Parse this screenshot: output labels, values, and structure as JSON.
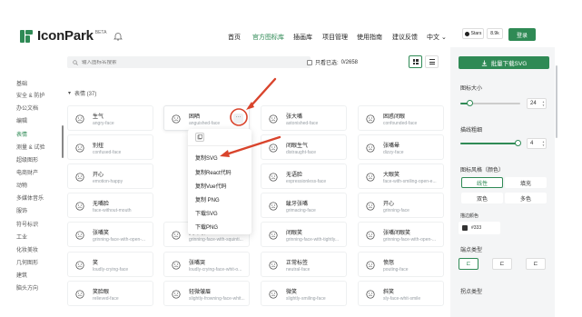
{
  "header": {
    "logo_text": "IconPark",
    "beta": "BETA",
    "nav": [
      {
        "label": "首页"
      },
      {
        "label": "官方图标库",
        "active": true
      },
      {
        "label": "插画库"
      },
      {
        "label": "项目管理"
      },
      {
        "label": "使用指南"
      },
      {
        "label": "建议反馈"
      },
      {
        "label": "中文 ⌄"
      }
    ],
    "github_label": "Stars",
    "stars_count": "8.9k",
    "login_label": "登录"
  },
  "toolbar": {
    "search_placeholder": "输入图标名搜索",
    "only_selected_label": "只看已选:",
    "selected_count": "0/2658"
  },
  "sidebar": {
    "items": [
      {
        "label": "基础"
      },
      {
        "label": "安全 & 防护"
      },
      {
        "label": "办公文档"
      },
      {
        "label": "编辑"
      },
      {
        "label": "表情",
        "active": true
      },
      {
        "label": "测量 & 试验"
      },
      {
        "label": "超级图形"
      },
      {
        "label": "电商财产"
      },
      {
        "label": "动物"
      },
      {
        "label": "多媒体音乐"
      },
      {
        "label": "服饰"
      },
      {
        "label": "符号标识"
      },
      {
        "label": "工业"
      },
      {
        "label": "化妆美妆"
      },
      {
        "label": "几何图形"
      },
      {
        "label": "建筑"
      },
      {
        "label": "脑头方向"
      }
    ]
  },
  "category": {
    "title": "表情 (37)"
  },
  "cards": [
    {
      "name": "生气",
      "sub": "angry-face"
    },
    {
      "name": "困晒",
      "sub": "anguished-face"
    },
    {
      "name": "张大嘴",
      "sub": "astonished-face"
    },
    {
      "name": "困惑闭眼",
      "sub": "confounded-face"
    },
    {
      "name": "别扭",
      "sub": "confused-face"
    },
    {
      "name": "",
      "sub": ""
    },
    {
      "name": "闭眼生气",
      "sub": "distraught-face"
    },
    {
      "name": "张嘴晕",
      "sub": "dizzy-face"
    },
    {
      "name": "开心",
      "sub": "emotion-happy"
    },
    {
      "name": "",
      "sub": ""
    },
    {
      "name": "无语脸",
      "sub": "expressionless-face"
    },
    {
      "name": "大眼笑",
      "sub": "face-with-smiling-open-e..."
    },
    {
      "name": "无嘴脸",
      "sub": "face-without-mouth"
    },
    {
      "name": "",
      "sub": ""
    },
    {
      "name": "龇牙张嘴",
      "sub": "grimacing-face"
    },
    {
      "name": "开心",
      "sub": "grinning-face"
    },
    {
      "name": "张嘴笑",
      "sub": "grinning-face-with-open-..."
    },
    {
      "name": "笑眯眼",
      "sub": "grinning-face-with-squinti..."
    },
    {
      "name": "闭眼笑",
      "sub": "grinning-face-with-tightly..."
    },
    {
      "name": "张嘴闭眼笑",
      "sub": "grinning-face-with-open-..."
    },
    {
      "name": "笑",
      "sub": "loudly-crying-face"
    },
    {
      "name": "张嘴哭",
      "sub": "loudly-crying-face-whit-o..."
    },
    {
      "name": "正常标签",
      "sub": "neutral-face"
    },
    {
      "name": "愤怒",
      "sub": "pouting-face"
    },
    {
      "name": "笑脸眼",
      "sub": "relieved-face"
    },
    {
      "name": "轻微皱眉",
      "sub": "slightly-frowning-face-whit..."
    },
    {
      "name": "微笑",
      "sub": "slightly-smiling-face"
    },
    {
      "name": "斜笑",
      "sub": "sly-face-whit-smile"
    }
  ],
  "menu": {
    "items": [
      {
        "label": "复制SVG"
      },
      {
        "label": "复制React代码"
      },
      {
        "label": "复制Vue代码"
      },
      {
        "label": "复制 PNG"
      },
      {
        "label": "下载SVG"
      },
      {
        "label": "下载PNG"
      }
    ]
  },
  "panel": {
    "download_label": "批量下载SVG",
    "size_label": "图标大小",
    "size_value": "24",
    "size_fraction": 0.15,
    "stroke_label": "描线粗细",
    "stroke_value": "4",
    "stroke_fraction": 0.95,
    "style_label": "图标风格（颜色）",
    "styles": [
      {
        "label": "线性",
        "active": true
      },
      {
        "label": "填充"
      },
      {
        "label": "双色"
      },
      {
        "label": "多色"
      }
    ],
    "stroke_color_label": "描边颜色",
    "stroke_color": "#333",
    "linecap_label": "端点类型",
    "linejoin_label": "拐点类型",
    "brand_color": "#2f8a55"
  }
}
